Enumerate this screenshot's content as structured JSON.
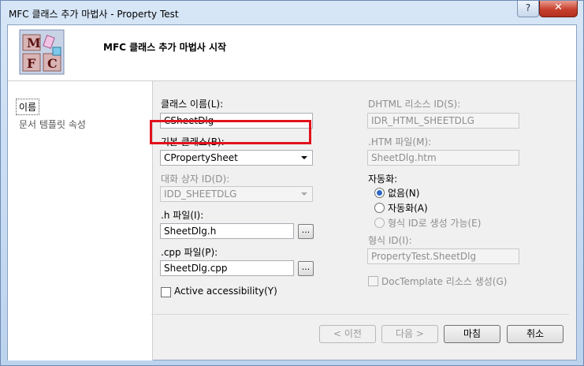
{
  "window": {
    "title": "MFC 클래스 추가 마법사 - Property Test",
    "help_glyph": "?",
    "close_glyph": "✕"
  },
  "header": {
    "title": "MFC 클래스 추가 마법사 시작",
    "logo_letters": [
      "M",
      "F",
      "C"
    ]
  },
  "sidebar": {
    "items": [
      {
        "label": "이름",
        "selected": true
      },
      {
        "label": "문서 템플릿 속성",
        "selected": false
      }
    ]
  },
  "form": {
    "class_name_label": "클래스 이름(L):",
    "class_name_value": "CSheetDlg",
    "base_class_label": "기본 클래스(B):",
    "base_class_value": "CPropertySheet",
    "dialog_id_label": "대화 상자 ID(D):",
    "dialog_id_value": "IDD_SHEETDLG",
    "h_file_label": ".h 파일(I):",
    "h_file_value": "SheetDlg.h",
    "cpp_file_label": ".cpp 파일(P):",
    "cpp_file_value": "SheetDlg.cpp",
    "browse_label": "...",
    "accessibility_label": "Active accessibility(Y)",
    "dhtml_id_label": "DHTML 리소스 ID(S):",
    "dhtml_id_value": "IDR_HTML_SHEETDLG",
    "htm_file_label": ".HTM 파일(M):",
    "htm_file_value": "SheetDlg.htm",
    "automation_label": "자동화:",
    "automation_options": [
      {
        "label": "없음(N)",
        "selected": true,
        "enabled": true
      },
      {
        "label": "자동화(A)",
        "selected": false,
        "enabled": true
      },
      {
        "label": "형식 ID로 생성 가능(E)",
        "selected": false,
        "enabled": false
      }
    ],
    "type_id_label": "형식 ID(I):",
    "type_id_value": "PropertyTest.SheetDlg",
    "doctemplate_label": "DocTemplate 리소스 생성(G)"
  },
  "buttons": {
    "prev": "< 이전",
    "next": "다음 >",
    "finish": "마침",
    "cancel": "취소"
  },
  "colors": {
    "highlight_border": "#e1121d",
    "radio_selected": "#2b68c7"
  }
}
